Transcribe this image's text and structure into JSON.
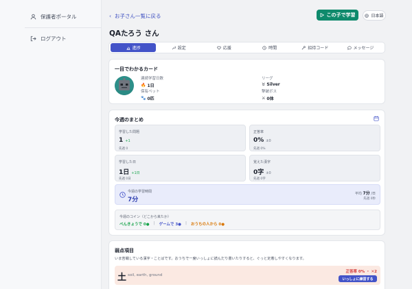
{
  "sidebar": {
    "portal_label": "保護者ポータル",
    "logout_label": "ログアウト"
  },
  "header": {
    "back_label": "お子さん一覧に戻る",
    "study_button_label": "この子で学習",
    "language_label": "日本語",
    "child_name": "QAたろう さん"
  },
  "tabs": [
    {
      "label": "進捗",
      "icon": "bar-chart-icon",
      "active": true
    },
    {
      "label": "設定",
      "icon": "wrench-icon",
      "active": false
    },
    {
      "label": "応援",
      "icon": "heart-icon",
      "active": false
    },
    {
      "label": "時間",
      "icon": "clock-icon",
      "active": false
    },
    {
      "label": "招待コード",
      "icon": "key-icon",
      "active": false
    },
    {
      "label": "メッセージ",
      "icon": "chat-icon",
      "active": false
    }
  ],
  "overview": {
    "title": "一目でわかるカード",
    "streak_label": "連続学習日数",
    "streak_value": "1日",
    "league_label": "リーグ",
    "league_value": "Silver",
    "pets_label": "保有ペット",
    "pets_value": "0匹",
    "bosses_label": "撃破ボス",
    "bosses_value": "0体"
  },
  "weekly": {
    "title": "今週のまとめ",
    "stats": [
      {
        "label": "学習した問題",
        "value": "1",
        "delta": "+1",
        "delta_color": "#16a34a",
        "prev": "先週 0"
      },
      {
        "label": "正答率",
        "value": "0%",
        "delta": "±0",
        "delta_color": "#6b7280",
        "prev": "先週 0%"
      },
      {
        "label": "学習した日",
        "value": "1日",
        "delta": "+1日",
        "delta_color": "#16a34a",
        "prev": "先週 0日"
      },
      {
        "label": "覚えた漢字",
        "value": "0字",
        "delta": "±0",
        "delta_color": "#6b7280",
        "prev": "先週 0字"
      }
    ],
    "time_label": "今週の学習時間",
    "time_value": "7分",
    "avg_label": "平均",
    "avg_value": "7分",
    "avg_unit": "/日",
    "prev_time": "先週 0秒",
    "coins_label": "今週のコイン（どこから来たか）",
    "coins": [
      {
        "label": "べんきょうで 0",
        "color": "#16a34a"
      },
      {
        "label": "ゲームで 3",
        "color": "#4353c8"
      },
      {
        "label": "おうちの人から 0",
        "color": "#d97706"
      }
    ]
  },
  "weak": {
    "title": "弱点項目",
    "description": "いま苦戦している漢字・ことばです。おうちで一度いっしょに読んだり書いたりすると、ぐっと定着しやすくなります。",
    "item_kanji": "土",
    "item_meaning": "soil, earth, ground",
    "item_stat": "正答率 0% ・ ✕2",
    "practice_label": "いっしょに練習する"
  },
  "colors": {
    "accent": "#4353c8",
    "primary_green": "#0f8a6c",
    "danger": "#d33a3a"
  }
}
